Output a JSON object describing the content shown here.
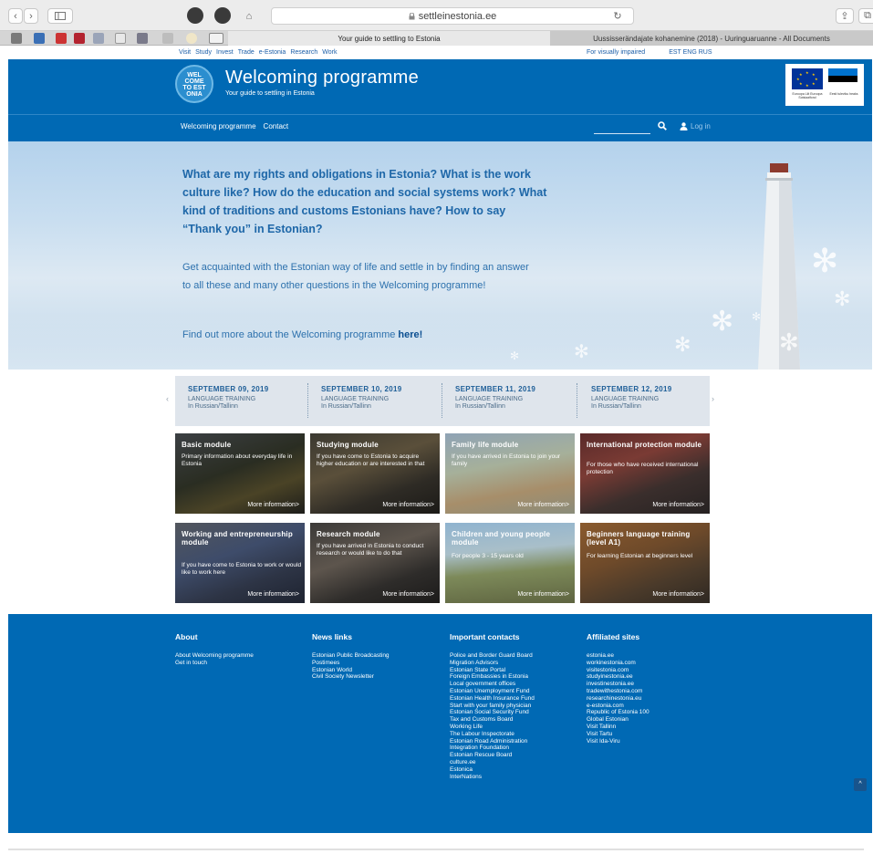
{
  "browser": {
    "url": "settleinestonia.ee",
    "active_tab": "Your guide to settling to Estonia",
    "inactive_tab": "Uussisserändajate kohanemine (2018) - Uuringuaruanne - All Documents"
  },
  "toplinks": {
    "left": [
      "Visit",
      "Study",
      "Invest",
      "Trade",
      "e-Estonia",
      "Research",
      "Work"
    ],
    "impaired": "For visually impaired",
    "langs": "EST ENG RUS"
  },
  "header": {
    "logo_lines": [
      "WEL",
      "COME",
      "TO EST",
      "ONIA"
    ],
    "title": "Welcoming programme",
    "subtitle": "Your guide to settling in Estonia",
    "eu_caption": "Euroopa Liit Euroopa Sotsiaalfond",
    "ee_caption": "Eesti tuleviku heaks"
  },
  "nav": {
    "items": [
      "Welcoming programme",
      "Contact"
    ],
    "login": "Log in"
  },
  "hero": {
    "questions": "What are my rights and obligations in Estonia? What is the work culture like? How do the education and social systems work? What kind of traditions and customs Estonians have? How to say “Thank you” in Estonian?",
    "intro": "Get acquainted with the Estonian way of life and settle in by finding an answer to all these and many other questions in the Welcoming programme!",
    "find_more": "Find out more about the Welcoming programme ",
    "here": "here!"
  },
  "events": [
    {
      "date": "SEPTEMBER 09, 2019",
      "title": "LANGUAGE TRAINING",
      "place": "In Russian/Tallinn"
    },
    {
      "date": "SEPTEMBER 10, 2019",
      "title": "LANGUAGE TRAINING",
      "place": "In Russian/Tallinn"
    },
    {
      "date": "SEPTEMBER 11, 2019",
      "title": "LANGUAGE TRAINING",
      "place": "In Russian/Tallinn"
    },
    {
      "date": "SEPTEMBER 12, 2019",
      "title": "LANGUAGE TRAINING",
      "place": "In Russian/Tallinn"
    }
  ],
  "modules": [
    {
      "title": "Basic module",
      "desc": "Primary information about everyday life in Estonia",
      "more": "More information>"
    },
    {
      "title": "Studying module",
      "desc": "If you have come to Estonia to acquire higher education or are interested in that",
      "more": "More information>"
    },
    {
      "title": "Family life module",
      "desc": "If you have arrived in Estonia to join your family",
      "more": "More information>"
    },
    {
      "title": "International protection module",
      "desc": "For those who have received international protection",
      "more": "More information>"
    },
    {
      "title": "Working and entrepreneurship module",
      "desc": "If you have come to Estonia to work or would like to work here",
      "more": "More information>"
    },
    {
      "title": "Research module",
      "desc": "If you have arrived in Estonia to conduct research or would like to do that",
      "more": "More information>"
    },
    {
      "title": "Children and young people module",
      "desc": "For people 3 - 15 years old",
      "more": "More information>"
    },
    {
      "title": "Beginners language training (level A1)",
      "desc": "For learning Estonian at beginners level",
      "more": "More information>"
    }
  ],
  "footer": {
    "about": {
      "title": "About",
      "items": [
        "About Welcoming programme",
        "Get in touch"
      ]
    },
    "news": {
      "title": "News links",
      "items": [
        "Estonian Public Broadcasting",
        "Postimees",
        "Estonian World",
        "Civil Society Newsletter"
      ]
    },
    "contacts": {
      "title": "Important contacts",
      "items": [
        "Police and Border Guard Board",
        "Migration Advisors",
        "Estonian State Portal",
        "Foreign Embassies in Estonia",
        "Local government offices",
        "Estonian Unemployment Fund",
        "Estonian Health Insurance Fund",
        "Start with your family physician",
        "Estonian Social Security Fund",
        "Tax and Customs Board",
        "Working Life",
        "The Labour Inspectorate",
        "Estonian Road Administration",
        "Integration Foundation",
        "Estonian Rescue Board",
        "culture.ee",
        "Estonica",
        "InterNations"
      ]
    },
    "affiliated": {
      "title": "Affiliated sites",
      "items": [
        "estonia.ee",
        "workinestonia.com",
        "visitestonia.com",
        "studyinestonia.ee",
        "investinestonia.ee",
        "tradewithestonia.com",
        "researchinestonia.eu",
        "e-estonia.com",
        "Republic of Estonia 100",
        "Global Estonian",
        "Visit Tallinn",
        "Visit Tartu",
        "Visit Ida-Viru"
      ]
    },
    "to_top": "^"
  }
}
